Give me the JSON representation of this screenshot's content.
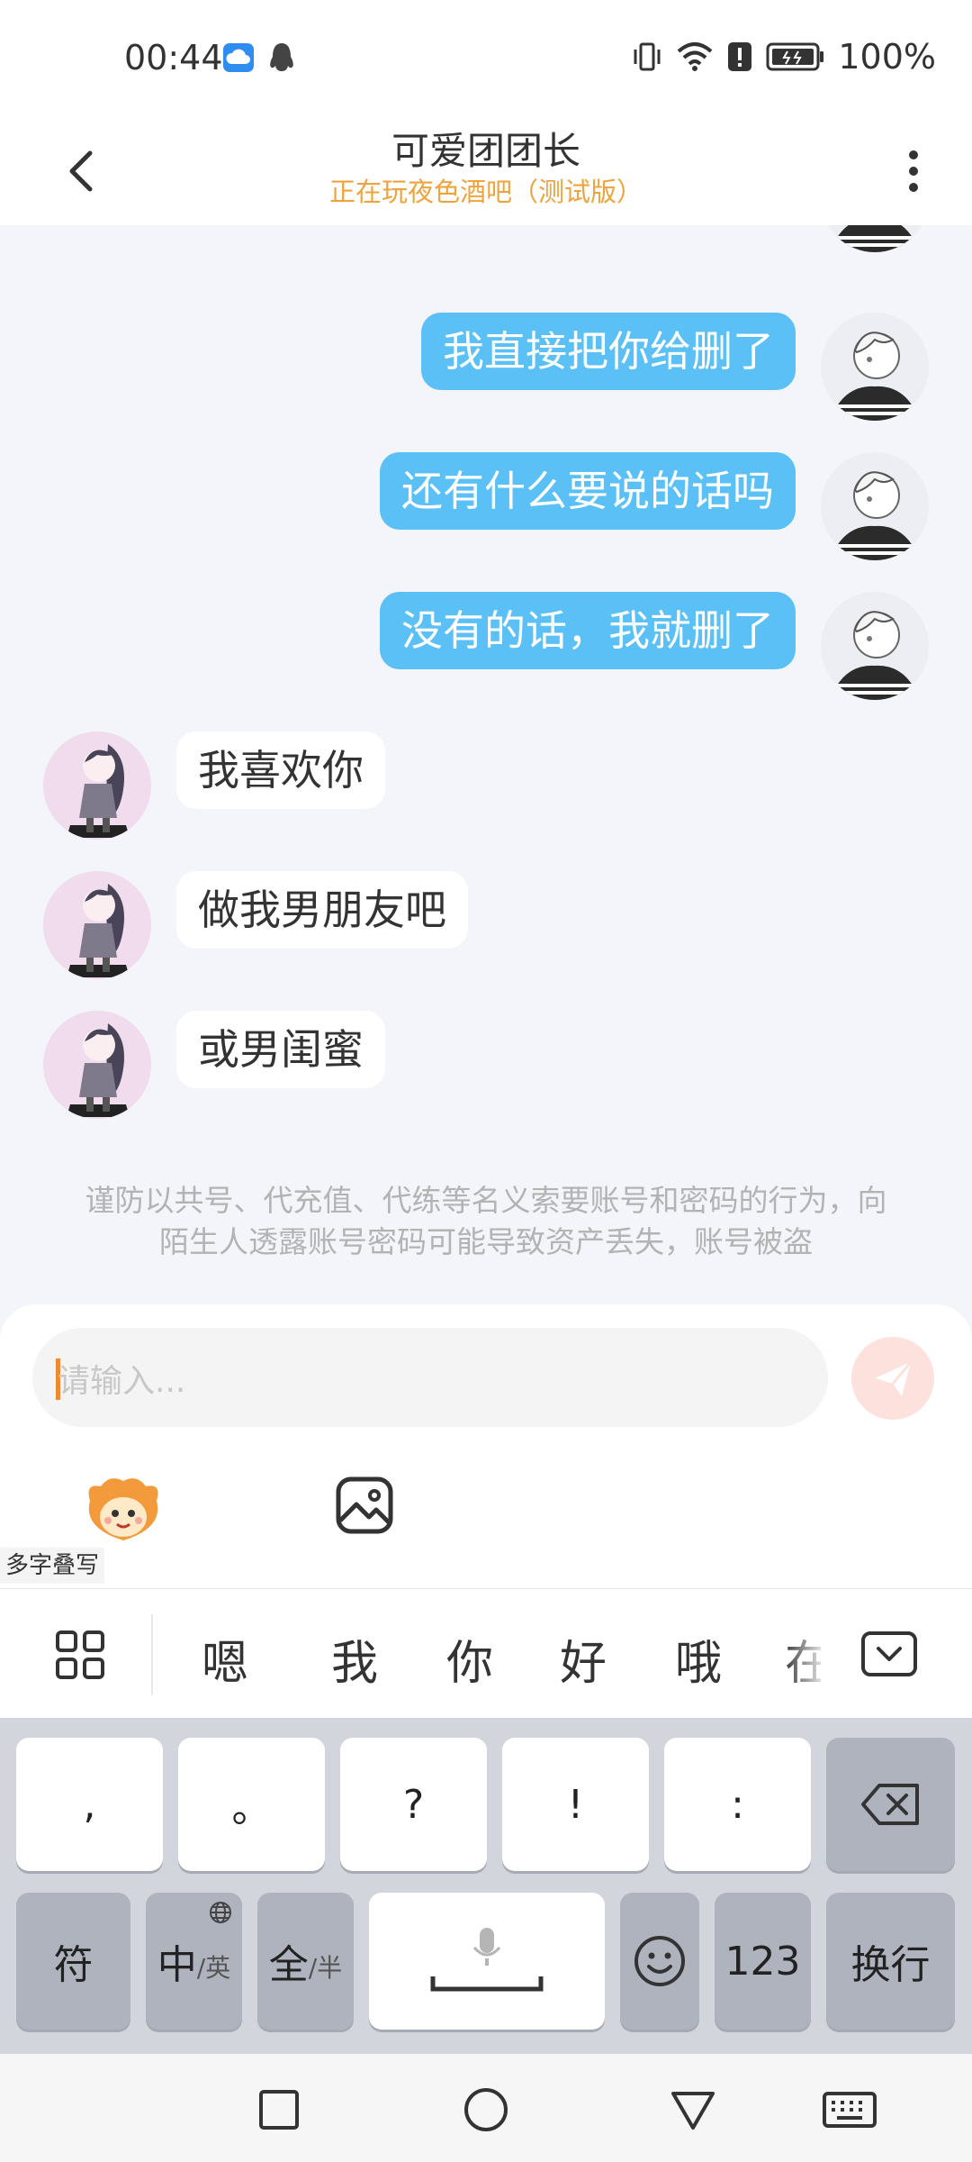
{
  "status_bar": {
    "time": "00:44",
    "battery": "100%"
  },
  "header": {
    "title": "可爱团团长",
    "subtitle": "正在玩夜色酒吧（测试版）"
  },
  "messages": [
    {
      "side": "right",
      "text": "我直接把你给删了"
    },
    {
      "side": "right",
      "text": "还有什么要说的话吗"
    },
    {
      "side": "right",
      "text": "没有的话，我就删了"
    },
    {
      "side": "left",
      "text": "我喜欢你"
    },
    {
      "side": "left",
      "text": "做我男朋友吧"
    },
    {
      "side": "left",
      "text": "或男闺蜜"
    }
  ],
  "notice": "谨防以共号、代充值、代练等名义索要账号和密码的行为，向陌生人透露账号密码可能导致资产丢失，账号被盗",
  "input": {
    "placeholder": "请输入..."
  },
  "ime": {
    "multi_write": "多字叠写",
    "candidates": [
      "嗯",
      "我",
      "你",
      "好",
      "哦",
      "在"
    ],
    "row1": [
      ",",
      "。",
      "?",
      "!",
      ":"
    ],
    "symbols": "符",
    "lang_main": "中",
    "lang_sub": "/英",
    "width_main": "全",
    "width_sub": "/半",
    "num": "123",
    "enter": "换行"
  },
  "colors": {
    "outgoing_bubble": "#5bc0f5",
    "subtitle": "#f0a33c",
    "caret": "#f08a2c"
  }
}
